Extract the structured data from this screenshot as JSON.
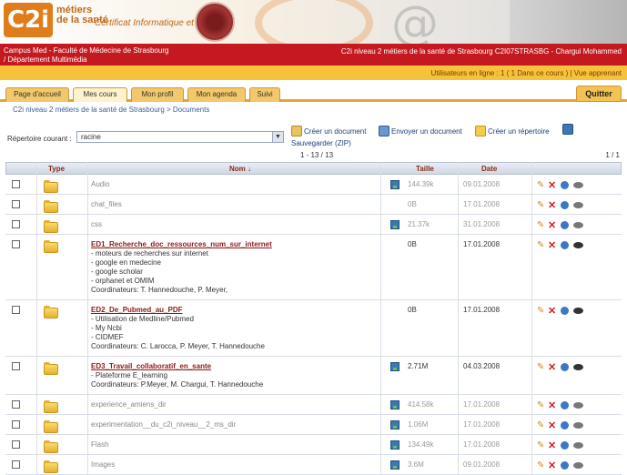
{
  "banner": {
    "logo_text": "C2i",
    "logo_subtitle_1": "métiers",
    "logo_subtitle_2": "de la santé",
    "logo_certificate": "Certificat Informatique et Internet"
  },
  "infobar": {
    "org_line_1": "Campus Med - Faculté de Médecine de Strasbourg",
    "org_line_2": "/ Département Multimédia",
    "course_user": "C2i niveau 2 métiers de la santé de Strasbourg C2I07STRASBG - Chargui Mohammed"
  },
  "online": {
    "text": "Utilisateurs en ligne : 1 ( 1 Dans ce cours ) | Vue apprenant"
  },
  "tabs": [
    {
      "label": "Page d'accueil"
    },
    {
      "label": "Mes cours"
    },
    {
      "label": "Mon profil"
    },
    {
      "label": "Mon agenda"
    },
    {
      "label": "Suivi"
    }
  ],
  "quit_label": "Quitter",
  "breadcrumb": "C2i niveau 2 métiers de la santé de Strasbourg > Documents",
  "directory": {
    "label": "Répertoire courant :",
    "value": "racine"
  },
  "actions": {
    "create_doc": "Créer un document",
    "send_doc": "Envoyer un document",
    "create_dir": "Créer un répertoire",
    "save_zip": "Sauvegarder (ZIP)"
  },
  "pager": "1 - 13 / 13",
  "page_num": "1 / 1",
  "table": {
    "headers": {
      "type": "Type",
      "name": "Nom ↓",
      "size": "Taille",
      "date": "Date"
    },
    "rows": [
      {
        "name": "Audio",
        "desc": [],
        "size": "144.39k",
        "date": "09.01.2008",
        "dim": true,
        "bold": false,
        "save": true
      },
      {
        "name": "chat_files",
        "desc": [],
        "size": "0B",
        "date": "17.01.2008",
        "dim": true,
        "bold": false,
        "save": false
      },
      {
        "name": "css",
        "desc": [],
        "size": "21.37k",
        "date": "31.01.2008",
        "dim": true,
        "bold": false,
        "save": true
      },
      {
        "name": "ED1_Recherche_doc_ressources_num_sur_internet",
        "desc": [
          "- moteurs de recherches sur internet",
          "- google en medecine",
          "- google scholar",
          "- orphanet et OMIM",
          "Coordinateurs: T. Hannedouche, P. Meyer,"
        ],
        "size": "0B",
        "date": "17.01.2008",
        "dim": false,
        "bold": true,
        "save": false
      },
      {
        "name": "ED2_De_Pubmed_au_PDF",
        "desc": [
          "- Utilisation de Medline/Pubmed",
          "- My Ncbi",
          "- CIDMEF",
          "Coordinateurs: C. Larocca, P. Meyer, T. Hannedouche"
        ],
        "size": "0B",
        "date": "17.01.2008",
        "dim": false,
        "bold": true,
        "save": false
      },
      {
        "name": "ED3_Travail_collaboratif_en_sante",
        "desc": [
          "- Plateforme E_learning",
          "Coordinateurs: P.Meyer, M. Chargui, T. Hannedouche"
        ],
        "size": "2.71M",
        "date": "04.03.2008",
        "dim": false,
        "bold": true,
        "save": true
      },
      {
        "name": "experience_amiens_dir",
        "desc": [],
        "size": "414.58k",
        "date": "17.01.2008",
        "dim": true,
        "bold": false,
        "save": true
      },
      {
        "name": "experimentation__du_c2i_niveau__2_ms_dir",
        "desc": [],
        "size": "1.06M",
        "date": "17.01.2008",
        "dim": true,
        "bold": false,
        "save": true
      },
      {
        "name": "Flash",
        "desc": [],
        "size": "134.49k",
        "date": "17.01.2008",
        "dim": true,
        "bold": false,
        "save": true
      },
      {
        "name": "Images",
        "desc": [],
        "size": "3.6M",
        "date": "09.01.2008",
        "dim": true,
        "bold": false,
        "save": true
      }
    ]
  }
}
